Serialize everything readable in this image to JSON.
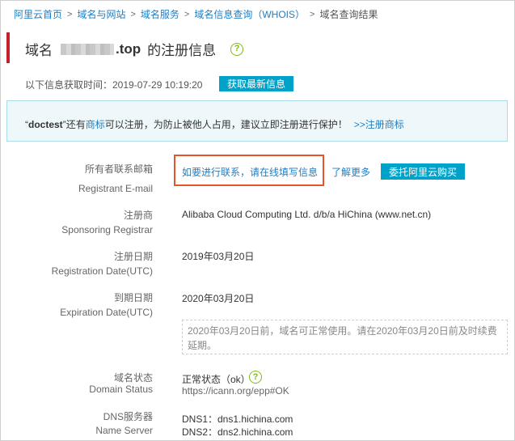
{
  "breadcrumb": {
    "items": [
      "阿里云首页",
      "域名与网站",
      "域名服务",
      "域名信息查询（WHOIS）"
    ],
    "current": "域名查询结果"
  },
  "title": {
    "prefix": "域名",
    "domain_suffix": ".top",
    "suffix": "的注册信息"
  },
  "fetch": {
    "label": "以下信息获取时间：2019-07-29 10:19:20",
    "button": "获取最新信息"
  },
  "notice": {
    "quote_open": "“",
    "name": "doctest",
    "quote_close": "”",
    "text1": "还有",
    "trademark_link": "商标",
    "text2": "可以注册，为防止被他人占用，建议立即注册进行保护！",
    "register_link": ">>注册商标"
  },
  "fields": {
    "email": {
      "label_cn": "所有者联系邮箱",
      "label_en": "Registrant E-mail",
      "contact_link": "如要进行联系，请在线填写信息",
      "more_link": "了解更多",
      "buy_button": "委托阿里云购买"
    },
    "registrar": {
      "label_cn": "注册商",
      "label_en": "Sponsoring Registrar",
      "value": "Alibaba Cloud Computing Ltd. d/b/a HiChina (www.net.cn)"
    },
    "reg_date": {
      "label_cn": "注册日期",
      "label_en": "Registration Date(UTC)",
      "value": "2019年03月20日"
    },
    "exp_date": {
      "label_cn": "到期日期",
      "label_en": "Expiration Date(UTC)",
      "value": "2020年03月20日",
      "tip": "2020年03月20日前，域名可正常使用。请在2020年03月20日前及时续费延期。"
    },
    "status": {
      "label_cn": "域名状态",
      "label_en": "Domain Status",
      "value": "正常状态（ok）",
      "url": "https://icann.org/epp#OK"
    },
    "dns": {
      "label_cn": "DNS服务器",
      "label_en": "Name Server",
      "dns1": "DNS1：dns1.hichina.com",
      "dns2": "DNS2：dns2.hichina.com"
    }
  },
  "icons": {
    "help": "help-circle-icon",
    "help_glyph": "?"
  },
  "colors": {
    "accent": "#00a2ca",
    "link": "#1f7ec2",
    "title_bar": "#c7202a",
    "highlight": "#e8542a",
    "help": "#7dbb18"
  }
}
